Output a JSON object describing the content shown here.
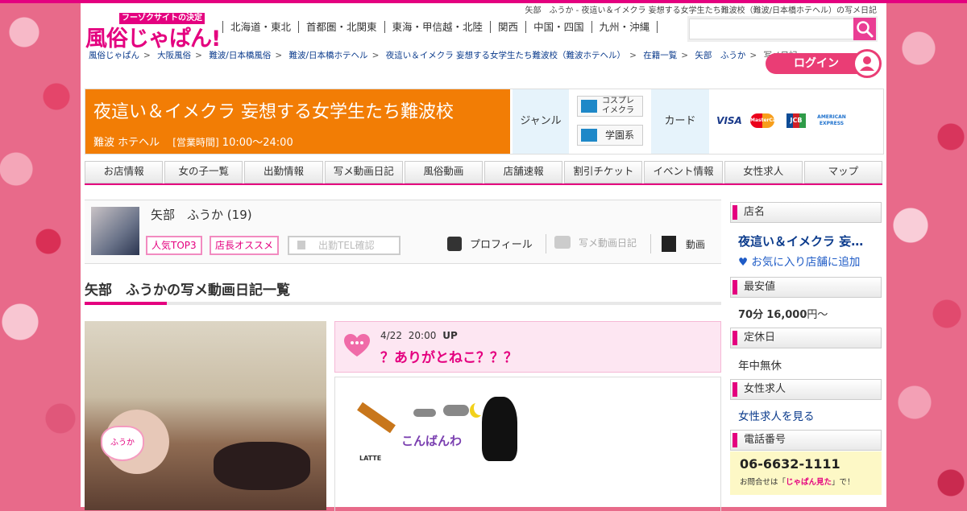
{
  "header": {
    "title_line": "矢部　ふうか - 夜這い＆イメクラ 妄想する女学生たち難波校（難波/日本橋ホテヘル）の写メ日記",
    "logo_tagline": "フーゾクサイトの決定版",
    "logo_text": "風俗じゃぱん!",
    "regions": [
      "北海道・東北",
      "首都圏・北関東",
      "東海・甲信越・北陸",
      "関西",
      "中国・四国",
      "九州・沖縄"
    ],
    "search_placeholder": "",
    "login_label": "ログイン"
  },
  "breadcrumbs": [
    "風俗じゃぱん",
    "大阪風俗",
    "難波/日本橋風俗",
    "難波/日本橋ホテヘル",
    "夜這い＆イメクラ 妄想する女学生たち難波校（難波ホテヘル）",
    "在籍一覧",
    "矢部　ふうか",
    "写メ日記"
  ],
  "shop": {
    "name": "夜這い＆イメクラ 妄想する女学生たち難波校",
    "area_type": "難波 ホテヘル",
    "hours_label": "[営業時間]",
    "hours": "10:00～24:00",
    "genre_label": "ジャンル",
    "genres": [
      "コスプレ\nイメクラ",
      "学園系"
    ],
    "card_label": "カード",
    "cards": [
      "VISA",
      "MasterCard",
      "JCB",
      "AMERICAN EXPRESS"
    ]
  },
  "tabs": [
    "お店情報",
    "女の子一覧",
    "出勤情報",
    "写メ動画日記",
    "風俗動画",
    "店舗速報",
    "割引チケット",
    "イベント情報",
    "女性求人",
    "マップ"
  ],
  "girl": {
    "name": "矢部　ふうか",
    "age": "(19)",
    "badges": [
      "人気TOP3",
      "店長オススメ"
    ],
    "tel_check": "出勤TEL確認",
    "links": [
      "プロフィール",
      "写メ動画日記",
      "動画"
    ]
  },
  "section_title": "矢部　ふうかの写メ動画日記一覧",
  "diary": {
    "date": "4/22",
    "time": "20:00",
    "up": "UP",
    "title": "？ありがとねこ？？？",
    "sticker_text": "こんばんわ",
    "sticker_small": "LATTE",
    "photo_label": "ふうか"
  },
  "sidebar": {
    "shop_h": "店名",
    "shop_name": "夜這い＆イメクラ 妄…",
    "fav": "♥ お気に入り店舗に追加",
    "price_h": "最安値",
    "price_min": "70分",
    "price_val": "16,000",
    "price_unit": "円～",
    "holiday_h": "定休日",
    "holiday": "年中無休",
    "recruit_h": "女性求人",
    "recruit": "女性求人を見る",
    "tel_h": "電話番号",
    "tel": "06-6632-1111",
    "tel_note_pre": "お問合せは「",
    "tel_note_key": "じゃぱん見た",
    "tel_note_post": "」で！"
  }
}
